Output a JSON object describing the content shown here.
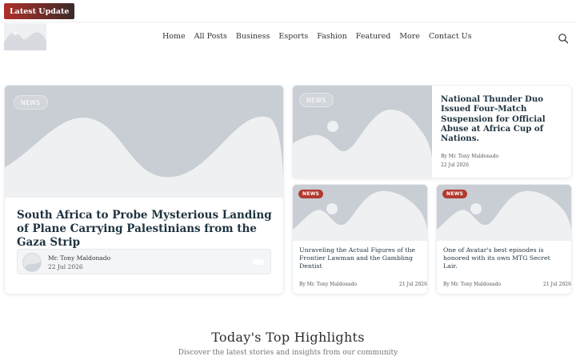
{
  "ticker": {
    "label": "Latest  Update"
  },
  "nav": {
    "items": [
      "Home",
      "All Posts",
      "Business",
      "Esports",
      "Fashion",
      "Featured",
      "More",
      "Contact Us"
    ]
  },
  "icons": {
    "search": "search-icon",
    "logo": "image-placeholder-icon",
    "avatar": "user-avatar-icon"
  },
  "colors": {
    "badge_red": "#b23a30",
    "placeholder": "#c8ced4",
    "ticker_start": "#b0312a",
    "ticker_end": "#3b2a2a"
  },
  "main_post": {
    "badge": "NEWS",
    "title": "South Africa to Probe Mysterious Landing of Plane Carrying Palestinians from the Gaza Strip",
    "author": "Mr. Tony Maldonado",
    "date": "22 Jul 2026"
  },
  "top_right_post": {
    "badge": "NEWS",
    "title": "National Thunder Duo Issued Four-Match Suspension for Official Abuse at Africa Cup of Nations.",
    "author": "By Mr. Tony Maldonado",
    "date": "22 Jul 2026"
  },
  "small_posts": [
    {
      "badge": "NEWS",
      "title": "Unraveling the Actual Figures of the Frontier Lawman and the Gambling Dentist",
      "author": "By Mr. Tony Maldonado",
      "date": "21 Jul 2026"
    },
    {
      "badge": "NEWS",
      "title": "One of Avatar's best episodes is honored with its own MTG Secret Lair.",
      "author": "By Mr. Tony Maldonado",
      "date": "21 Jul 2026"
    }
  ],
  "highlights": {
    "title": "Today's Top Highlights",
    "subtitle": "Discover the latest stories and insights from our community"
  }
}
